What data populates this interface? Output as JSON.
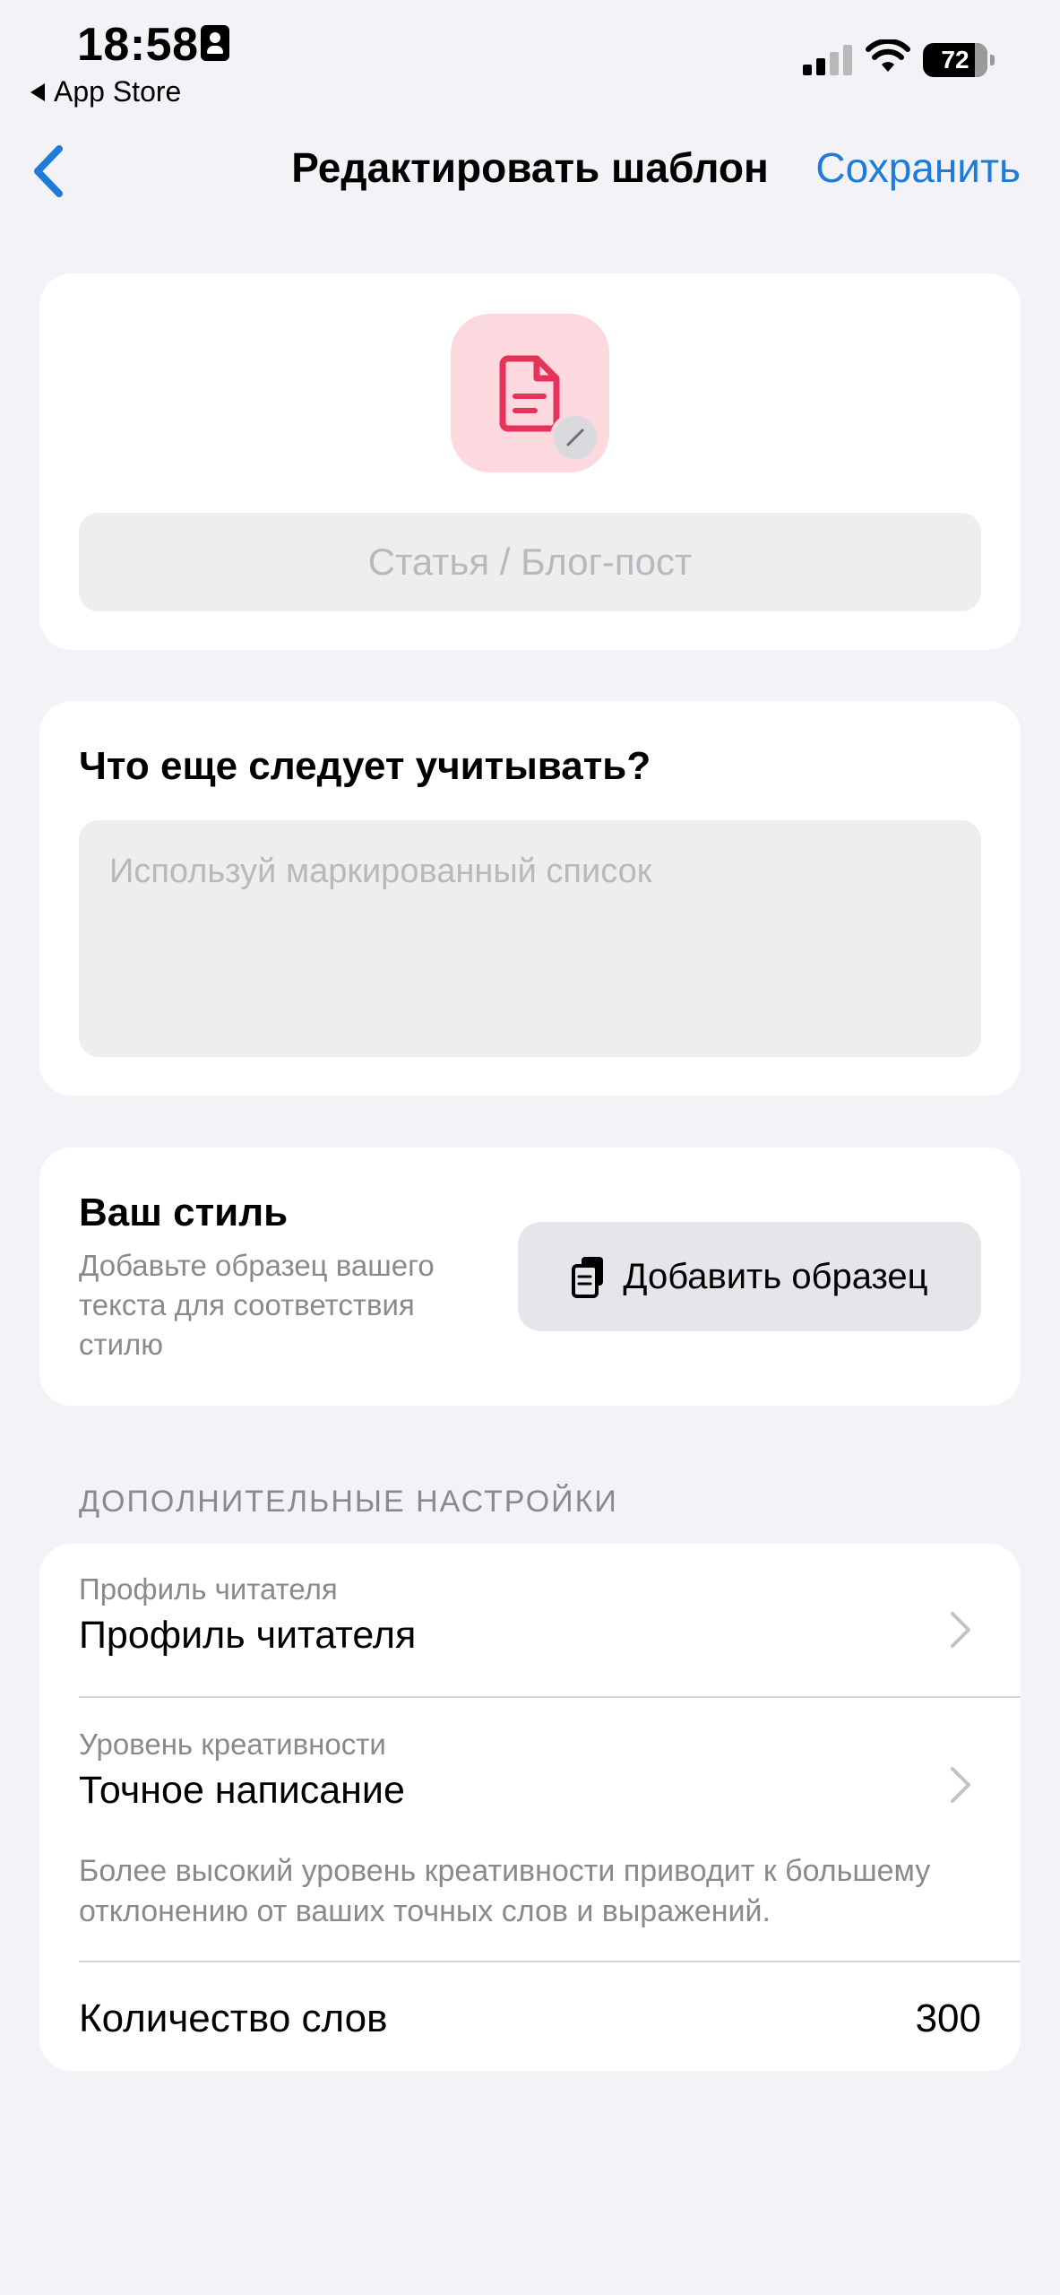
{
  "status_bar": {
    "time": "18:58",
    "back_app": "App Store",
    "battery": "72"
  },
  "nav": {
    "title": "Редактировать шаблон",
    "save_label": "Сохранить"
  },
  "template": {
    "title_placeholder": "Статья / Блог-пост",
    "title_value": "",
    "icon_color": "#e5335a",
    "icon_bg": "#fcd9de"
  },
  "considerations": {
    "heading": "Что еще следует учитывать?",
    "placeholder": "Используй маркированный список",
    "value": ""
  },
  "style": {
    "heading": "Ваш стиль",
    "description": "Добавьте образец вашего текста для соответствия стилю",
    "add_button_label": "Добавить образец"
  },
  "advanced": {
    "section_title": "ДОПОЛНИТЕЛЬНЫЕ НАСТРОЙКИ",
    "reader_profile": {
      "label": "Профиль читателя",
      "value": "Профиль читателя"
    },
    "creativity": {
      "label": "Уровень креативности",
      "value": "Точное написание",
      "hint": "Более высокий уровень креативности приводит к большему отклонению от ваших точных слов и выражений."
    },
    "word_count": {
      "label": "Количество слов",
      "value": "300"
    }
  },
  "colors": {
    "accent": "#1e7bd8",
    "background": "#f2f2f7"
  }
}
